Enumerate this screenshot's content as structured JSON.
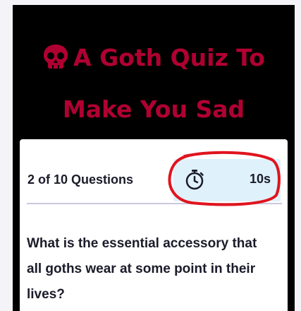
{
  "quiz": {
    "title": "A Goth Quiz To Make You Sad",
    "title_icon": "skull-icon",
    "progress": "2 of 10 Questions",
    "timer_icon": "stopwatch-icon",
    "timer_value": "10s",
    "question": "What is the essential accessory that all goths wear at some point in their lives?"
  },
  "colors": {
    "title": "#b00032",
    "header_bg": "#000000",
    "timer_bg": "#dff1fb",
    "annotation": "#e0141e"
  }
}
